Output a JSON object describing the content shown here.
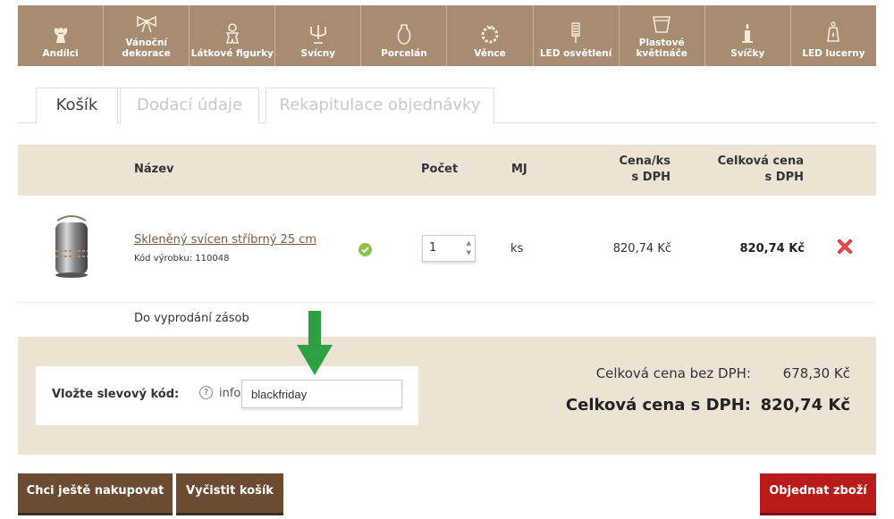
{
  "categories": [
    {
      "label": "Andílci",
      "icon": "angel-icon"
    },
    {
      "label": "Vánoční dekorace",
      "icon": "bow-icon"
    },
    {
      "label": "Látkové figurky",
      "icon": "gingerbread-icon"
    },
    {
      "label": "Svícny",
      "icon": "candelabra-icon"
    },
    {
      "label": "Porcelán",
      "icon": "vase-icon"
    },
    {
      "label": "Věnce",
      "icon": "wreath-icon"
    },
    {
      "label": "LED osvětlení",
      "icon": "led-bulb-icon"
    },
    {
      "label": "Plastové květináče",
      "icon": "flowerpot-icon"
    },
    {
      "label": "Svíčky",
      "icon": "candle-icon"
    },
    {
      "label": "LED lucerny",
      "icon": "lantern-icon"
    }
  ],
  "tabs": [
    "Košík",
    "Dodací údaje",
    "Rekapitulace objednávky"
  ],
  "table_header": {
    "name": "Název",
    "qty": "Počet",
    "unit": "MJ",
    "unit_price_1": "Cena/ks",
    "unit_price_2": "s DPH",
    "total_1": "Celková cena",
    "total_2": "s DPH"
  },
  "product": {
    "name": "Skleněný svícen stříbrný 25 cm",
    "code": "Kód výrobku: 110048",
    "quantity": "1",
    "unit": "ks",
    "unit_price": "820,74 Kč",
    "total_price": "820,74 Kč",
    "availability": "Do vyprodání zásob"
  },
  "voucher": {
    "label": "Vložte slevový kód:",
    "info": "info",
    "info_icon_glyph": "?",
    "value": "blackfriday"
  },
  "summary": {
    "without_vat_label": "Celková cena bez DPH:",
    "without_vat_value": "678,30 Kč",
    "with_vat_label": "Celková cena s DPH:",
    "with_vat_value": "820,74 Kč"
  },
  "buttons": {
    "continue": "Chci ještě nakupovat",
    "clear": "Vyčistit košík",
    "order": "Objednat zboží"
  },
  "colors": {
    "nav_bg": "#a88c71",
    "header_bg": "#ede3d5",
    "brown_button": "#6b4c32",
    "red_button": "#b91b1b",
    "arrow_green": "#2ea043"
  }
}
